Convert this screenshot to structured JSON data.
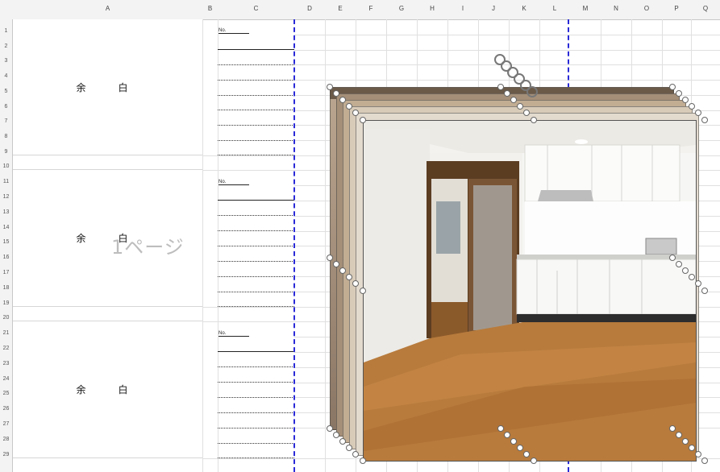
{
  "columns": [
    "A",
    "B",
    "C",
    "D",
    "E",
    "F",
    "G",
    "H",
    "I",
    "J",
    "K",
    "L",
    "M",
    "N",
    "O",
    "P",
    "Q"
  ],
  "rows": [
    "1",
    "2",
    "3",
    "4",
    "5",
    "6",
    "7",
    "8",
    "9",
    "10",
    "11",
    "12",
    "13",
    "14",
    "15",
    "16",
    "17",
    "18",
    "19",
    "20",
    "21",
    "22",
    "23",
    "24",
    "25",
    "26",
    "27",
    "28",
    "29"
  ],
  "margin_blocks": [
    {
      "text": "余　白"
    },
    {
      "text": "余　白"
    },
    {
      "text": "余　白"
    }
  ],
  "label_marks": [
    "No.",
    "No.",
    "No."
  ],
  "page_watermark": "1ページ",
  "colors": {
    "page_break": "#2a2ad8",
    "header_bg": "#f3f3f3",
    "grid": "#e0e0e0"
  },
  "picture": {
    "name": "kitchen-room-photo",
    "description_icon": "image-icon"
  }
}
